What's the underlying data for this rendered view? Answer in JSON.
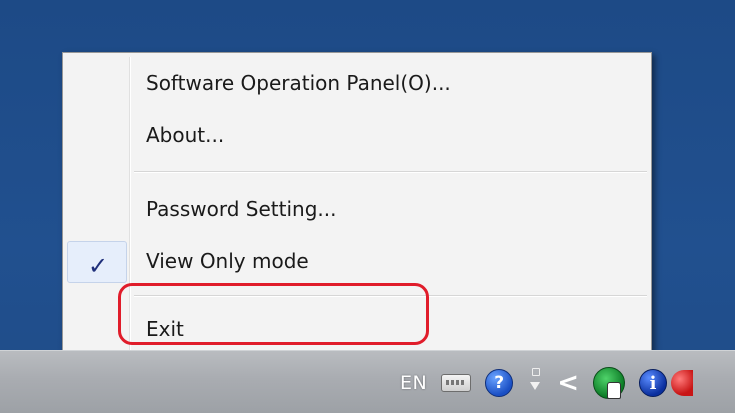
{
  "menu": {
    "items": [
      {
        "label": "Software Operation Panel(O)..."
      },
      {
        "label": "About..."
      },
      {
        "label": "Password Setting..."
      },
      {
        "label": "View Only mode",
        "checked": true,
        "check_glyph": "✓"
      },
      {
        "label": "Exit"
      }
    ]
  },
  "taskbar": {
    "language": "EN",
    "tray_icons": [
      "keyboard-icon",
      "help-icon",
      "flag-icon",
      "chevron-left-icon",
      "scanner-icon",
      "info-icon",
      "red-icon"
    ],
    "help_glyph": "?",
    "chevron_glyph": "<",
    "info_glyph": "i"
  },
  "colors": {
    "desktop": "#1f4e8c",
    "menu_background": "#f3f3f3",
    "highlight_ring": "#e01c2a"
  }
}
